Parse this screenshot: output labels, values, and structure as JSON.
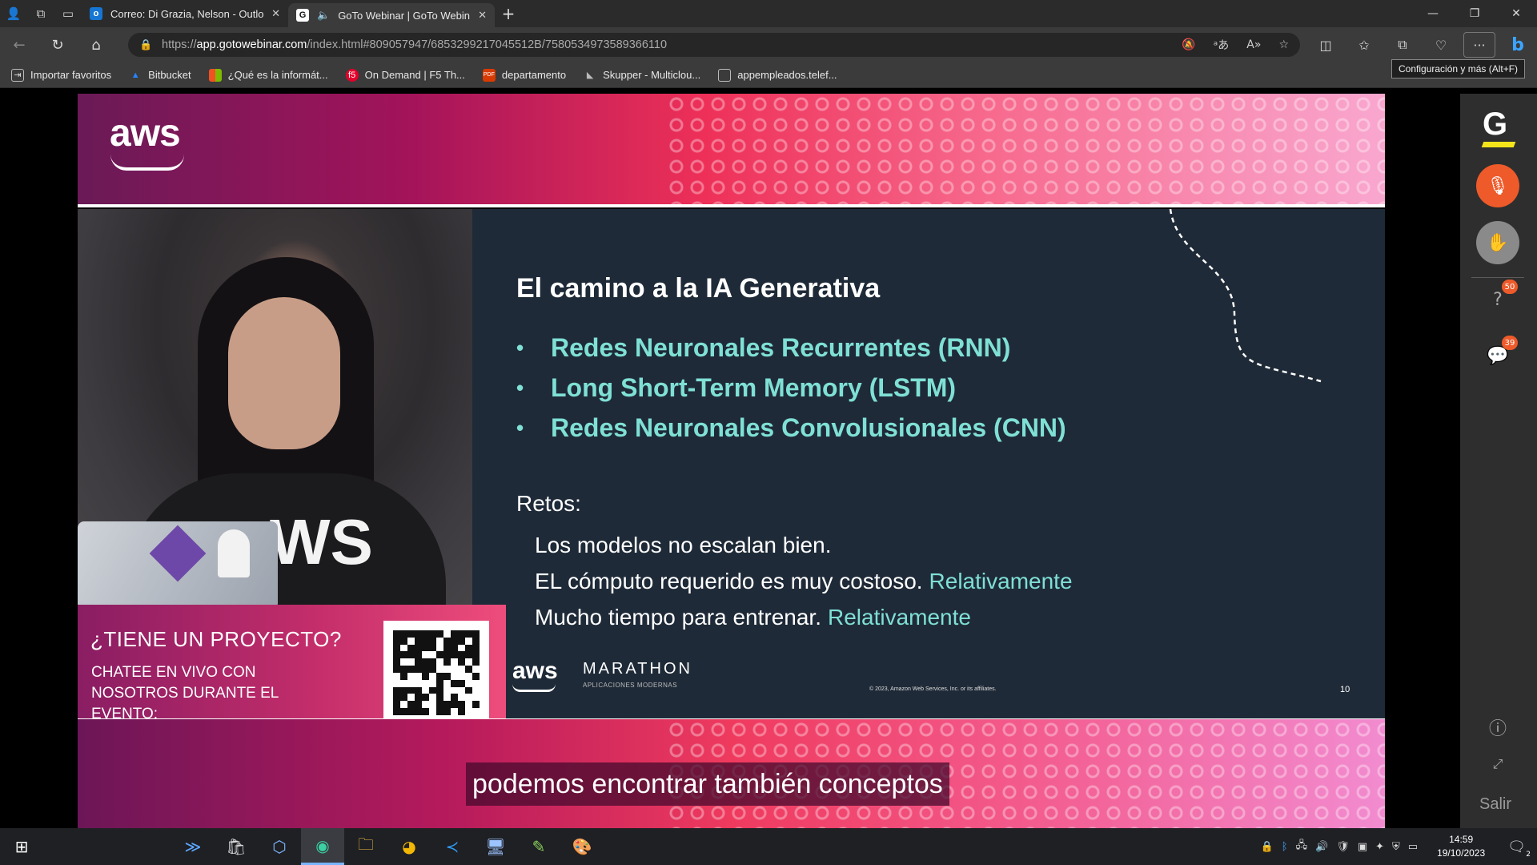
{
  "browser": {
    "tabs": [
      {
        "title": "Correo: Di Grazia, Nelson - Outlo",
        "favicon": "outlook-icon",
        "active": false
      },
      {
        "title": "GoTo Webinar | GoTo Webin",
        "favicon": "goto-icon",
        "active": true
      }
    ],
    "url_prefix": "https://",
    "url_domain": "app.gotowebinar.com",
    "url_rest": "/index.html#809057947/6853299217045512B/7580534973589366110",
    "tooltip": "Configuración y más (Alt+F)",
    "bookmarks": [
      {
        "label": "Importar favoritos",
        "icon": "import-icon"
      },
      {
        "label": "Bitbucket",
        "icon": "bitbucket-icon"
      },
      {
        "label": "¿Qué es la informát...",
        "icon": "microsoft-icon"
      },
      {
        "label": "On Demand | F5 Th...",
        "icon": "f5-icon"
      },
      {
        "label": "departamento",
        "icon": "pdf-icon"
      },
      {
        "label": "Skupper - Multiclou...",
        "icon": "skupper-icon"
      },
      {
        "label": "appempleados.telef...",
        "icon": "page-icon"
      }
    ]
  },
  "slide": {
    "title": "El camino a la IA Generativa",
    "bullets": [
      "Redes Neuronales Recurrentes (RNN)",
      "Long Short-Term Memory (LSTM)",
      "Redes Neuronales Convolusionales (CNN)"
    ],
    "retos_title": "Retos:",
    "retos": [
      {
        "text": "Los modelos no escalan bien.",
        "highlight": ""
      },
      {
        "text": "EL cómputo requerido es muy costoso.",
        "highlight": "Relativamente"
      },
      {
        "text": "Mucho tiempo para entrenar.",
        "highlight": "Relativamente"
      }
    ],
    "aws_logo": "aws",
    "marathon": "MARATHON",
    "marathon_sub": "APLICACIONES MODERNAS",
    "copyright": "© 2023, Amazon Web Services, Inc. or its affiliates.",
    "page_number": "10",
    "top_logo": "aws"
  },
  "video": {
    "shirt_text": "WS"
  },
  "promo": {
    "title": "¿TIENE UN PROYECTO?",
    "text": "CHATEE EN VIVO CON NOSOTROS DURANTE EL EVENTO:"
  },
  "caption": "podemos encontrar también conceptos",
  "goto_panel": {
    "logo": "G",
    "questions_badge": "50",
    "chat_badge": "39",
    "exit_label": "Salir"
  },
  "taskbar": {
    "time": "14:59",
    "date": "19/10/2023",
    "notification_count": "2"
  },
  "colors": {
    "accent_teal": "#7fe0d5",
    "slide_bg": "#1f2a38",
    "mic_orange": "#ee5a2a"
  }
}
